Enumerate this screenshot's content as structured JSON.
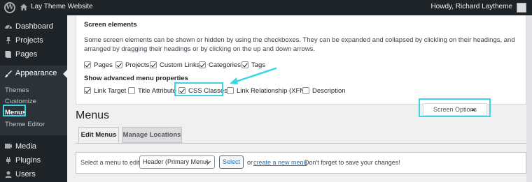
{
  "adminbar": {
    "site_name": "Lay Theme Website",
    "howdy": "Howdy, Richard Laytheme"
  },
  "sidebar": {
    "items": [
      {
        "label": "Dashboard",
        "icon": "dashboard-icon"
      },
      {
        "label": "Projects",
        "icon": "pin-icon"
      },
      {
        "label": "Pages",
        "icon": "pages-icon"
      },
      {
        "label": "Appearance",
        "icon": "brush-icon"
      },
      {
        "label": "Media",
        "icon": "media-icon"
      },
      {
        "label": "Plugins",
        "icon": "plugin-icon"
      },
      {
        "label": "Users",
        "icon": "users-icon"
      }
    ],
    "submenu": [
      "Themes",
      "Customize",
      "Menus",
      "Theme Editor"
    ]
  },
  "screen_options": {
    "title": "Screen elements",
    "description": "Some screen elements can be shown or hidden by using the checkboxes. They can be expanded and collapsed by clickling on their headings, and arranged by dragging their headings or by clicking on the up and down arrows.",
    "elements": [
      {
        "label": "Pages",
        "checked": true
      },
      {
        "label": "Projects",
        "checked": true
      },
      {
        "label": "Custom Links",
        "checked": true
      },
      {
        "label": "Categories",
        "checked": true
      },
      {
        "label": "Tags",
        "checked": true
      }
    ],
    "advanced_title": "Show advanced menu properties",
    "advanced": [
      {
        "label": "Link Target",
        "checked": true
      },
      {
        "label": "Title Attribute",
        "checked": false
      },
      {
        "label": "CSS Classes",
        "checked": true
      },
      {
        "label": "Link Relationship (XFN)",
        "checked": false
      },
      {
        "label": "Description",
        "checked": false
      }
    ],
    "button_label": "Screen Options"
  },
  "page": {
    "title": "Menus",
    "tabs": [
      "Edit Menus",
      "Manage Locations"
    ]
  },
  "manage": {
    "label": "Select a menu to edit:",
    "selected_menu": "Header (Primary Menu)",
    "select_button": "Select",
    "or_text": "or",
    "create_link": "create a new menu",
    "rest": ". Don't forget to save your changes!"
  },
  "colors": {
    "highlight": "#3ad6e4",
    "sidebar_bg": "#1d2327",
    "link": "#2271b1"
  }
}
